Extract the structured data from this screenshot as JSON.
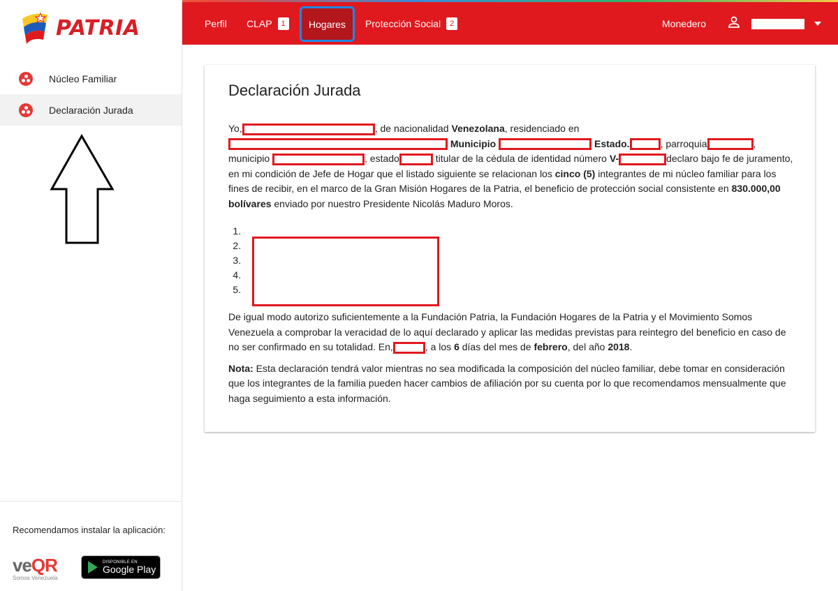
{
  "brand": {
    "name": "PATRIA"
  },
  "sidebar": {
    "items": [
      {
        "label": "Núcleo Familiar",
        "icon": "patria-dots-icon",
        "active": false
      },
      {
        "label": "Declaración Jurada",
        "icon": "patria-dots-icon",
        "active": true
      }
    ],
    "recommend_text": "Recomendamos instalar la aplicación:",
    "veqr": {
      "label_ve": "ve",
      "label_qr": "QR",
      "sub": "Somos Venezuela"
    },
    "google_play": {
      "small": "DISPONIBLE EN",
      "big": "Google Play"
    }
  },
  "nav": {
    "perfil": "Perfil",
    "clap": "CLAP",
    "clap_badge": "1",
    "hogares": "Hogares",
    "proteccion": "Protección Social",
    "proteccion_badge": "2",
    "monedero": "Monedero"
  },
  "colors": {
    "brand_red": "#e0191f",
    "highlight_blue": "#1e88e5"
  },
  "content": {
    "title": "Declaración Jurada",
    "p1": {
      "yo": "Yo,",
      "nacionalidad_pre": ", de nacionalidad ",
      "nacionalidad": "Venezolana",
      "residenciado": ", residenciado en",
      "municipio_label": "Municipio",
      "estado_label": "Estado.",
      "parroquia": ", parroquia",
      "municipio_lower": ", municipio",
      "estado_lower": ", estado",
      "titular": "titular de la cédula de identidad número ",
      "cedula_prefix": "V-",
      "declaro": "declaro bajo fe de juramento, en mi condición de Jefe de Hogar que el listado siguiente se relacionan los ",
      "cinco": "cinco (5)",
      "integrantes": " integrantes de mi núcleo familiar para los fines de recibir, en el marco de la Gran Misión Hogares de la Patria, el beneficio de protección social consistente en ",
      "monto": "830.000,00 bolívares",
      "enviado": " enviado por nuestro Presidente Nicolás Maduro Moros."
    },
    "members": [
      "",
      "",
      "",
      "",
      ""
    ],
    "p2": {
      "text": "De igual modo autorizo suficientemente a la Fundación Patria, la Fundación Hogares de la Patria y el Movimiento Somos Venezuela a comprobar la veracidad de lo aquí declarado y aplicar las medidas previstas para reintegro del beneficio en caso de no ser confirmado en su totalidad. En,",
      "a_los": ", a los ",
      "dia": "6",
      "dias_del_mes": " días del mes de ",
      "mes": "febrero",
      "del_ano": ", del año ",
      "ano": "2018",
      "end": "."
    },
    "note": {
      "label": "Nota:",
      "text": " Esta declaración tendrá valor mientras no sea modificada la composición del núcleo familiar, debe tomar en consideración que los integrantes de la familia pueden hacer cambios de afiliación por su cuenta por lo que recomendamos mensualmente que haga seguimiento a esta información."
    }
  }
}
